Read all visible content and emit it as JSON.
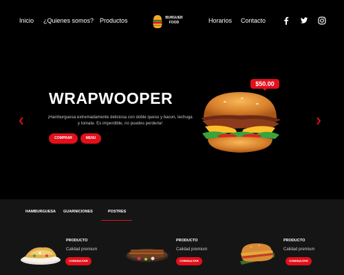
{
  "nav": {
    "links": [
      "Inicio",
      "¿Quienes  somos?",
      "Productos",
      "Horarios",
      "Contacto"
    ],
    "logo_line1": "BURGUER",
    "logo_line2": "FOOD",
    "social_icons": [
      "facebook-icon",
      "twitter-icon",
      "instagram-icon"
    ]
  },
  "hero": {
    "title": "WRAPWOOPER",
    "description": "¡Hamburguesa extremadamente deliciosa con doble queso y bacon, lechuga y tomate. Es imperdible, no puedes perderla!",
    "buy_label": "COMPRAR",
    "menu_label": "MENU",
    "price": "$50.00",
    "prev_icon": "chevron-left-icon",
    "next_icon": "chevron-right-icon"
  },
  "products": {
    "tabs": [
      "HAMBURGUESA",
      "GUARNICIONES",
      "POSTRES"
    ],
    "active_tab": "POSTRES",
    "cards": [
      {
        "title": "PRODUCTO",
        "subtitle": "Calidad premium",
        "button": "CONSULTAR"
      },
      {
        "title": "PRODUCTO",
        "subtitle": "Calidad premium",
        "button": "CONSULTAR"
      },
      {
        "title": "PRODUCTO",
        "subtitle": "Calidad premium",
        "button": "CONSULTAR"
      }
    ]
  },
  "colors": {
    "accent": "#e3101b",
    "background": "#000000",
    "section_background": "#151515"
  }
}
